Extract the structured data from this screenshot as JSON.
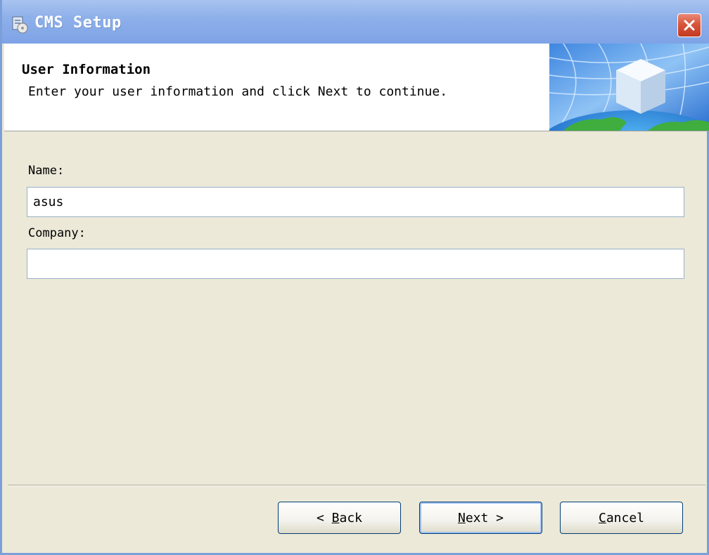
{
  "window": {
    "title": "CMS Setup"
  },
  "header": {
    "title": "User Information",
    "description": "Enter your user information and click Next to continue."
  },
  "form": {
    "name_label": "Name:",
    "name_value": "asus",
    "company_label": "Company:",
    "company_value": ""
  },
  "buttons": {
    "back": {
      "prefix": "< ",
      "mnemonic": "B",
      "rest": "ack"
    },
    "next": {
      "mnemonic": "N",
      "rest": "ext",
      "suffix": " >"
    },
    "cancel": {
      "mnemonic": "C",
      "rest": "ancel"
    }
  },
  "icons": {
    "title_icon": "installer-icon",
    "close": "close-icon",
    "header_graphic": "globe-cube-graphic"
  },
  "colors": {
    "titlebar": "#8eb0ea",
    "close_button": "#d9553c",
    "dialog_background": "#ece9d8"
  }
}
